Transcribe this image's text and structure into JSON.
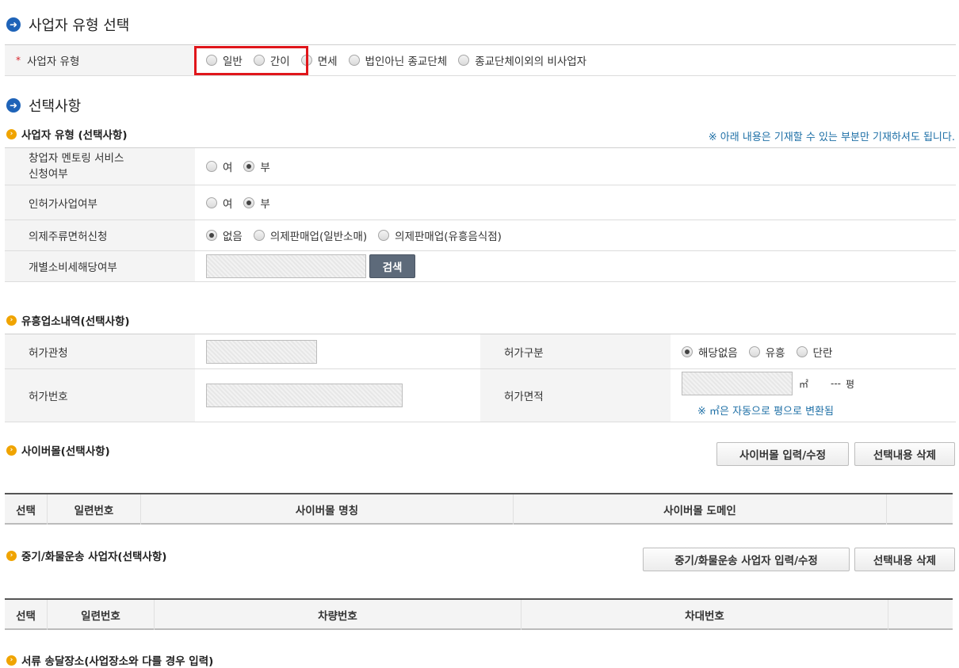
{
  "section1": {
    "title": "사업자 유형 선택"
  },
  "biz_type": {
    "required_mark": "*",
    "label": "사업자 유형",
    "options": [
      "일반",
      "간이",
      "면세",
      "법인아닌 종교단체",
      "종교단체이외의 비사업자"
    ]
  },
  "section2": {
    "title": "선택사항"
  },
  "optional_biz": {
    "title": "사업자 유형 (선택사항)",
    "note": "※ 아래 내용은 기재할 수 있는 부분만 기재하셔도 됩니다.",
    "mentoring": {
      "label_line1": "창업자 멘토링 서비스",
      "label_line2": "신청여부",
      "opt_yes": "여",
      "opt_no": "부"
    },
    "license_biz": {
      "label": "인허가사업여부",
      "opt_yes": "여",
      "opt_no": "부"
    },
    "liquor": {
      "label": "의제주류면허신청",
      "options": [
        "없음",
        "의제판매업(일반소매)",
        "의제판매업(유흥음식점)"
      ]
    },
    "excise": {
      "label": "개별소비세해당여부",
      "search_button": "검색"
    }
  },
  "entertainment": {
    "title": "유흥업소내역(선택사항)",
    "permit_office_label": "허가관청",
    "permit_type_label": "허가구분",
    "permit_type_options": [
      "해당없음",
      "유흥",
      "단란"
    ],
    "permit_no_label": "허가번호",
    "permit_area_label": "허가면적",
    "area_unit": "㎡",
    "pyeong_value": "---",
    "pyeong_unit": "평",
    "area_note": "※ ㎡은 자동으로 평으로 변환됨"
  },
  "cybermall": {
    "title": "사이버몰(선택사항)",
    "edit_button": "사이버몰 입력/수정",
    "delete_button": "선택내용 삭제",
    "columns": [
      "선택",
      "일련번호",
      "사이버몰 명칭",
      "사이버몰 도메인"
    ]
  },
  "freight": {
    "title": "중기/화물운송 사업자(선택사항)",
    "edit_button": "중기/화물운송 사업자 입력/수정",
    "delete_button": "선택내용 삭제",
    "columns": [
      "선택",
      "일련번호",
      "차량번호",
      "차대번호"
    ]
  },
  "delivery": {
    "title": "서류 송달장소(사업장소와 다를 경우 입력)"
  }
}
